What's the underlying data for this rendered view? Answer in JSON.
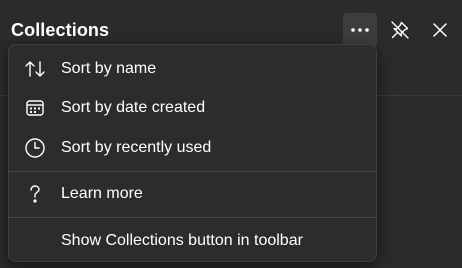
{
  "header": {
    "title": "Collections",
    "more_icon": "more-horizontal-icon",
    "pin_icon": "unpin-icon",
    "close_icon": "close-icon"
  },
  "menu": {
    "items": [
      {
        "label": "Sort by name",
        "icon": "sort-arrows-icon"
      },
      {
        "label": "Sort by date created",
        "icon": "calendar-icon"
      },
      {
        "label": "Sort by recently used",
        "icon": "clock-icon"
      },
      {
        "label": "Learn more",
        "icon": "question-icon"
      },
      {
        "label": "Show Collections button in toolbar",
        "icon": ""
      }
    ]
  },
  "colors": {
    "background": "#2b2b2b",
    "menu_background": "#2c2c2c",
    "text": "#ffffff",
    "separator": "#474747"
  }
}
